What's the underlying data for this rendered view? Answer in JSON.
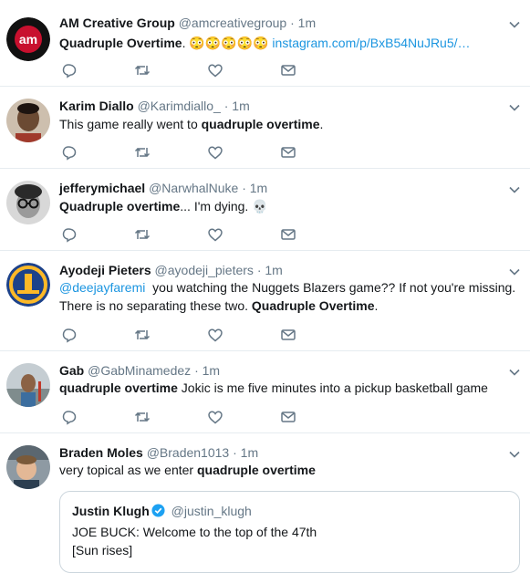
{
  "tweets": [
    {
      "name": "AM Creative Group",
      "handle": "@amcreativegroup",
      "time": "1m",
      "bold_text": "Quadruple Overtime",
      "text_after": ". 😳😳😳😳😳 ",
      "link": "instagram.com/p/BxB54NuJRu5/…"
    },
    {
      "name": "Karim Diallo",
      "handle": "@Karimdiallo_",
      "time": "1m",
      "text_before": "This game really went to ",
      "bold_text": "quadruple overtime",
      "text_after": "."
    },
    {
      "name": "jefferymichael",
      "handle": "@NarwhalNuke",
      "time": "1m",
      "bold_text": "Quadruple overtime",
      "text_after": "... I'm dying. 💀"
    },
    {
      "name": "Ayodeji Pieters",
      "handle": "@ayodeji_pieters",
      "time": "1m",
      "mention": "@deejayfaremi",
      "text_line1": "  you watching the Nuggets Blazers game?? If not you're missing.",
      "text_line2": "There is no separating these two. ",
      "bold_text": "Quadruple Overtime",
      "text_after": "."
    },
    {
      "name": "Gab",
      "handle": "@GabMinamedez",
      "time": "1m",
      "bold_text": "quadruple overtime",
      "text_after": " Jokic is me five minutes into a pickup basketball game"
    },
    {
      "name": "Braden Moles",
      "handle": "@Braden1013",
      "time": "1m",
      "text_before": "very topical as we enter ",
      "bold_text": "quadruple overtime",
      "quote": {
        "name": "Justin Klugh",
        "handle": "@justin_klugh",
        "line1": "JOE BUCK: Welcome to the top of the 47th",
        "line2": "[Sun rises]"
      }
    }
  ],
  "separator": "·",
  "avatar_logo_text": "am",
  "colors": {
    "link": "#1b95e0",
    "muted": "#657786",
    "border": "#e6ecf0"
  },
  "icons": [
    "reply-icon",
    "retweet-icon",
    "like-icon",
    "message-icon",
    "chevron-down-icon",
    "verified-icon"
  ]
}
